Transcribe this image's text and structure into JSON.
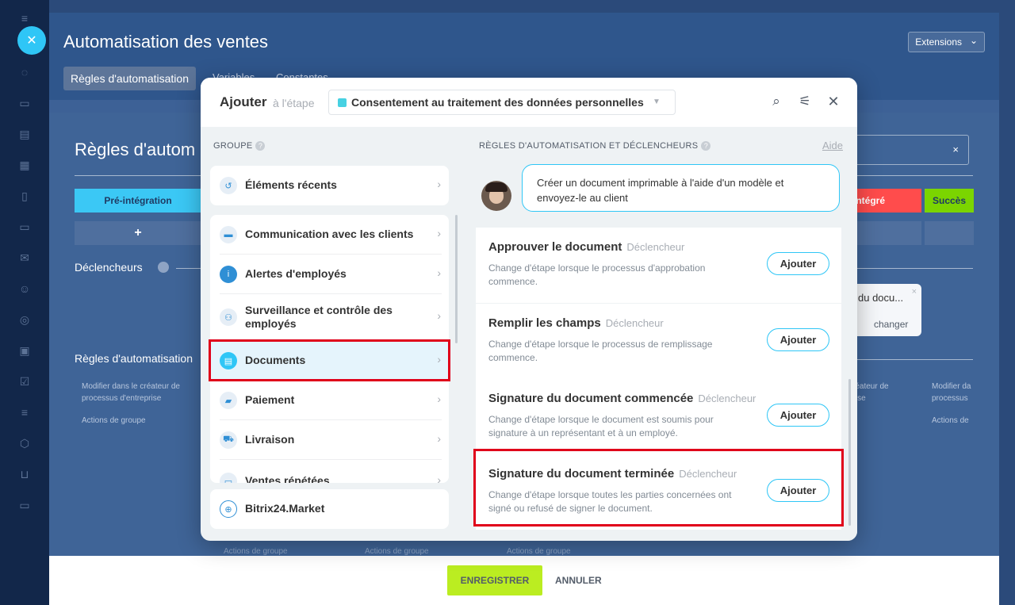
{
  "slider": {
    "title": "Automatisation des ventes",
    "extensions_label": "Extensions",
    "tabs": [
      "Règles d'automatisation",
      "Variables",
      "Constantes"
    ],
    "heading": "Règles d'autom",
    "stage_left": "Pré-intégration",
    "stage_right_1": "intégré",
    "stage_right_2": "Succès",
    "plus": "+",
    "triggers_label": "Déclencheurs",
    "rules_label": "Règles d'automatisation",
    "card_text": "du docu...",
    "card_change": "changer",
    "left_small_1": "Modifier dans le créateur de processus d'entreprise",
    "left_small_2": "Actions de groupe",
    "right_small_1": "créateur de prise",
    "right_small_2": "e",
    "right_small_3": "Modifier da processus",
    "right_small_4": "Actions de",
    "footer_labels": [
      "Actions de groupe",
      "Actions de groupe",
      "Actions de groupe"
    ],
    "search_clear": "×"
  },
  "footer": {
    "save": "ENREGISTRER",
    "cancel": "ANNULER"
  },
  "dialog": {
    "title": "Ajouter",
    "subtitle": "à l'étape",
    "stage_value": "Consentement au traitement des données personnelles",
    "accent": "#2fc6f6",
    "group_header": "GROUPE",
    "rules_header": "RÈGLES D'AUTOMATISATION ET DÉCLENCHEURS",
    "aide": "Aide",
    "bubble_text": "Créer un document imprimable à l'aide d'un modèle et envoyez-le au client",
    "groups": [
      {
        "label": "Éléments récents",
        "icon": "history-icon"
      },
      {
        "label": "Communication avec les clients",
        "icon": "chat-icon"
      },
      {
        "label": "Alertes d'employés",
        "icon": "info-icon"
      },
      {
        "label": "Surveillance et contrôle des employés",
        "icon": "users-icon"
      },
      {
        "label": "Documents",
        "icon": "document-icon",
        "selected": true
      },
      {
        "label": "Paiement",
        "icon": "wallet-icon"
      },
      {
        "label": "Livraison",
        "icon": "truck-icon"
      },
      {
        "label": "Ventes répétées",
        "icon": "repeat-icon"
      },
      {
        "label": "Bitrix24.Market",
        "icon": "market-icon"
      }
    ],
    "trigger_kind": "Déclencheur",
    "add_label": "Ajouter",
    "triggers": [
      {
        "name": "Approuver le document",
        "desc": "Change d'étape lorsque le processus d'approbation commence."
      },
      {
        "name": "Remplir les champs",
        "desc": "Change d'étape lorsque le processus de remplissage commence."
      },
      {
        "name": "Signature du document commencée",
        "desc": "Change d'étape lorsque le document est soumis pour signature à un représentant et à un employé."
      },
      {
        "name": "Signature du document terminée",
        "desc": "Change d'étape lorsque toutes les parties concernées ont signé ou refusé de signer le document."
      }
    ]
  }
}
